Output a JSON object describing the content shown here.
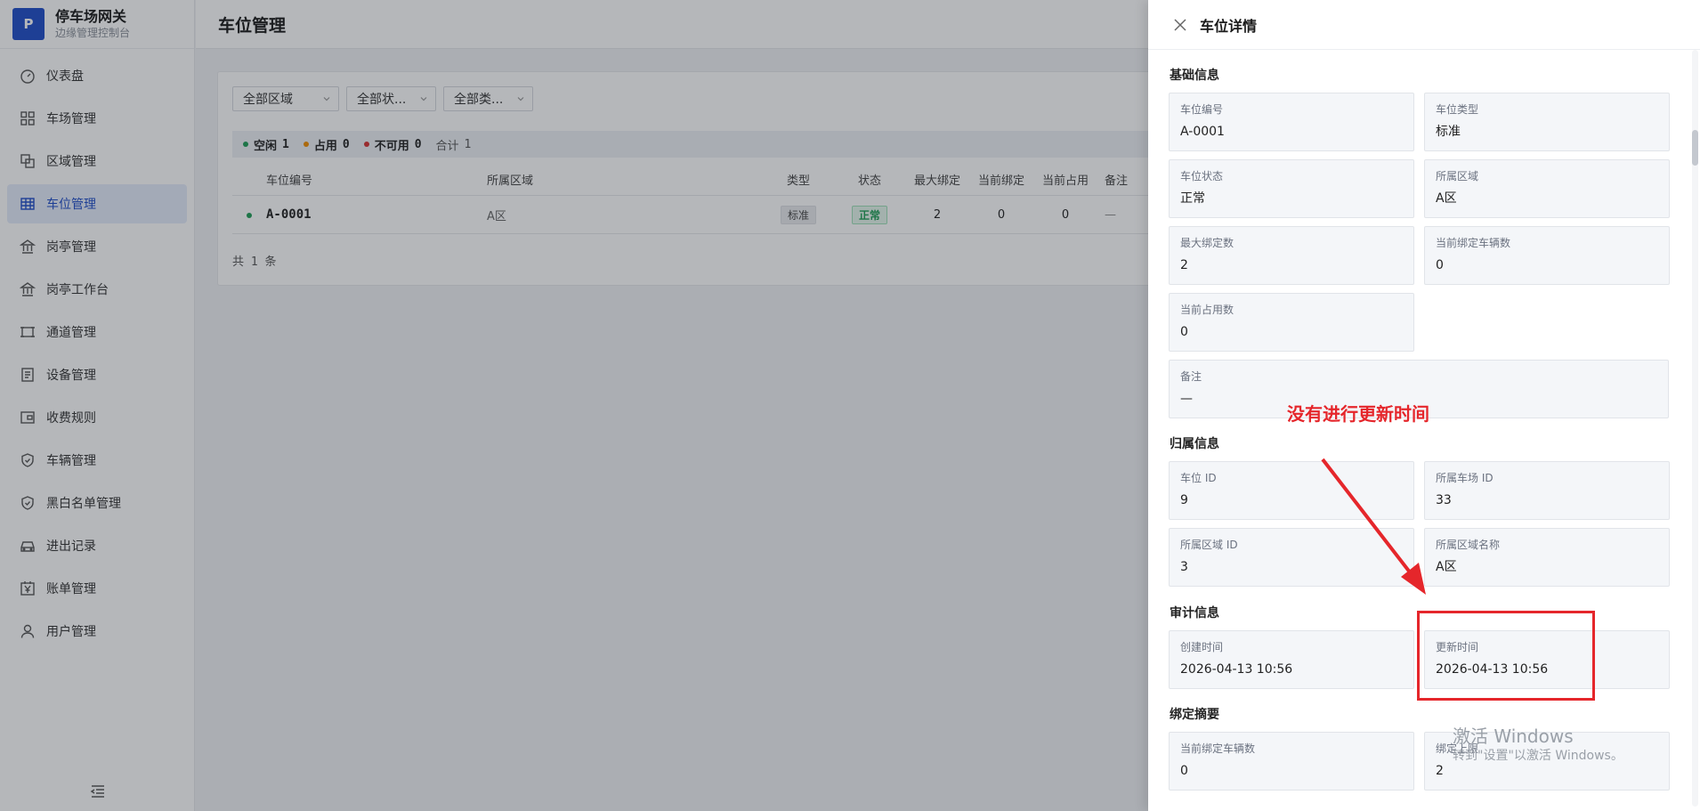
{
  "brand": {
    "logo_letter": "P",
    "title": "停车场网关",
    "subtitle": "边缘管理控制台"
  },
  "sidebar": {
    "items": [
      {
        "label": "仪表盘",
        "icon": "dashboard-icon"
      },
      {
        "label": "车场管理",
        "icon": "grid-icon"
      },
      {
        "label": "区域管理",
        "icon": "area-icon"
      },
      {
        "label": "车位管理",
        "icon": "table-icon",
        "active": true
      },
      {
        "label": "岗亭管理",
        "icon": "bank-icon"
      },
      {
        "label": "岗亭工作台",
        "icon": "bank-icon"
      },
      {
        "label": "通道管理",
        "icon": "channel-icon"
      },
      {
        "label": "设备管理",
        "icon": "device-icon"
      },
      {
        "label": "收费规则",
        "icon": "wallet-icon"
      },
      {
        "label": "车辆管理",
        "icon": "shield-icon"
      },
      {
        "label": "黑白名单管理",
        "icon": "shield-check-icon"
      },
      {
        "label": "进出记录",
        "icon": "car-icon"
      },
      {
        "label": "账单管理",
        "icon": "yen-icon"
      },
      {
        "label": "用户管理",
        "icon": "user-icon"
      }
    ]
  },
  "header": {
    "title": "车位管理"
  },
  "filters": {
    "zone": "全部区域",
    "status": "全部状...",
    "type": "全部类..."
  },
  "summary": {
    "free_label": "空闲",
    "free_count": "1",
    "occupied_label": "占用",
    "occupied_count": "0",
    "unavailable_label": "不可用",
    "unavailable_count": "0",
    "total_label": "合计",
    "total_count": "1"
  },
  "table": {
    "headers": {
      "code": "车位编号",
      "zone": "所属区域",
      "type": "类型",
      "status": "状态",
      "max": "最大绑定",
      "current": "当前绑定",
      "occupied": "当前占用",
      "note": "备注"
    },
    "rows": [
      {
        "code": "A-0001",
        "zone": "A区",
        "type": "标准",
        "status": "正常",
        "max": "2",
        "current": "0",
        "occupied": "0",
        "note": "—"
      }
    ],
    "count_text": "共 1 条"
  },
  "drawer": {
    "title": "车位详情",
    "basic": {
      "title": "基础信息",
      "code_label": "车位编号",
      "code": "A-0001",
      "type_label": "车位类型",
      "type": "标准",
      "status_label": "车位状态",
      "status": "正常",
      "zone_label": "所属区域",
      "zone": "A区",
      "max_label": "最大绑定数",
      "max": "2",
      "cur_label": "当前绑定车辆数",
      "cur": "0",
      "occ_label": "当前占用数",
      "occ": "0",
      "note_label": "备注",
      "note": "—"
    },
    "owner": {
      "title": "归属信息",
      "spot_id_label": "车位 ID",
      "spot_id": "9",
      "lot_id_label": "所属车场 ID",
      "lot_id": "33",
      "zone_id_label": "所属区域 ID",
      "zone_id": "3",
      "zone_name_label": "所属区域名称",
      "zone_name": "A区"
    },
    "audit": {
      "title": "审计信息",
      "created_label": "创建时间",
      "created": "2026-04-13 10:56",
      "updated_label": "更新时间",
      "updated": "2026-04-13 10:56"
    },
    "binding": {
      "title": "绑定摘要",
      "cur_label": "当前绑定车辆数",
      "cur": "0",
      "limit_label": "绑定上限",
      "limit": "2"
    }
  },
  "annotation": {
    "text": "没有进行更新时间"
  },
  "watermark": {
    "title": "激活 Windows",
    "subtitle": "转到\"设置\"以激活 Windows。"
  },
  "colors": {
    "accent": "#1e4cc8",
    "annotation": "#e5262b",
    "free": "#1f9d55",
    "occupied": "#f08c00",
    "unavailable": "#d63031"
  }
}
